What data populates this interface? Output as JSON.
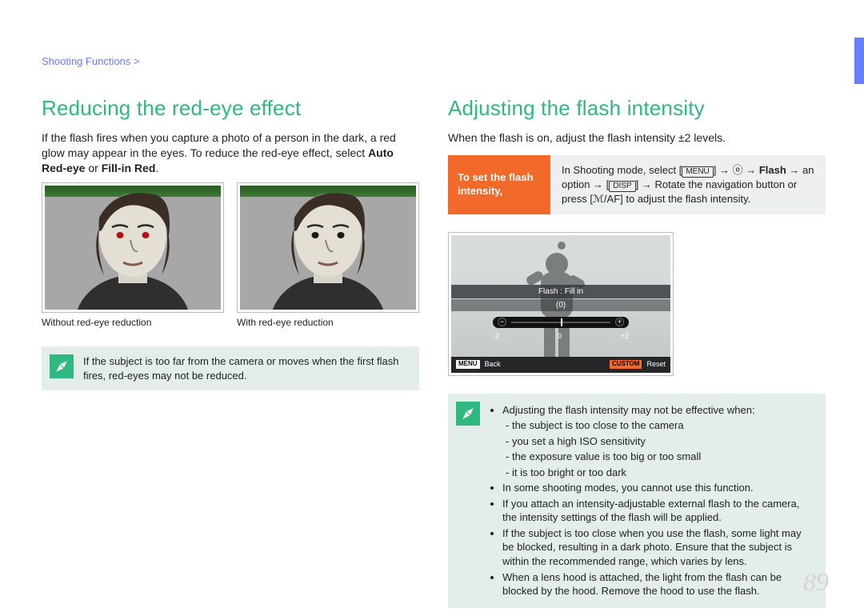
{
  "breadcrumb": "Shooting Functions >",
  "page_number": "89",
  "left": {
    "heading": "Reducing the red-eye effect",
    "para_a": "If the flash fires when you capture a photo of a person in the dark, a red glow may appear in the eyes. To reduce the red-eye effect, select ",
    "para_bold": "Auto Red-eye",
    "para_b": " or ",
    "para_bold2": "Fill-in Red",
    "para_end": ".",
    "caption_without": "Without red-eye reduction",
    "caption_with": "With red-eye reduction",
    "note": "If the subject is too far from the camera or moves when the first flash fires, red-eyes may not be reduced."
  },
  "right": {
    "heading": "Adjusting the flash intensity",
    "para": "When the flash is on, adjust the flash intensity ±2 levels.",
    "instr_label": "To set the flash intensity,",
    "instr_pre": "In Shooting mode, select [",
    "instr_menu": "MENU",
    "instr_a": "] → ⓞ → ",
    "instr_flash": "Flash",
    "instr_b": " → an option → [",
    "instr_disp": "DISP",
    "instr_c": "] → Rotate the navigation button or press [",
    "instr_af": "ℳ/AF",
    "instr_d": "] to adjust the flash intensity.",
    "screen": {
      "mode": "Flash : Fill in",
      "value": "(0)",
      "minus": "−",
      "plus": "+",
      "t_minus2": "-2",
      "t_zero": "0",
      "t_plus2": "+2",
      "menu": "MENU",
      "back": "Back",
      "custom": "CUSTOM",
      "reset": "Reset"
    },
    "notes": {
      "n1": "Adjusting the flash intensity may not be effective when:",
      "n1a": "the subject is too close to the camera",
      "n1b": "you set a high ISO sensitivity",
      "n1c": "the exposure value is too big or too small",
      "n1d": "it is too bright or too dark",
      "n2": "In some shooting modes, you cannot use this function.",
      "n3": "If you attach an intensity-adjustable external flash to the camera, the intensity settings of the flash will be applied.",
      "n4": "If the subject is too close when you use the flash, some light may be blocked, resulting in a dark photo. Ensure that the subject is within the recommended range, which varies by lens.",
      "n5": "When a lens hood is attached, the light from the flash can be blocked by the hood. Remove the hood to use the flash."
    }
  }
}
